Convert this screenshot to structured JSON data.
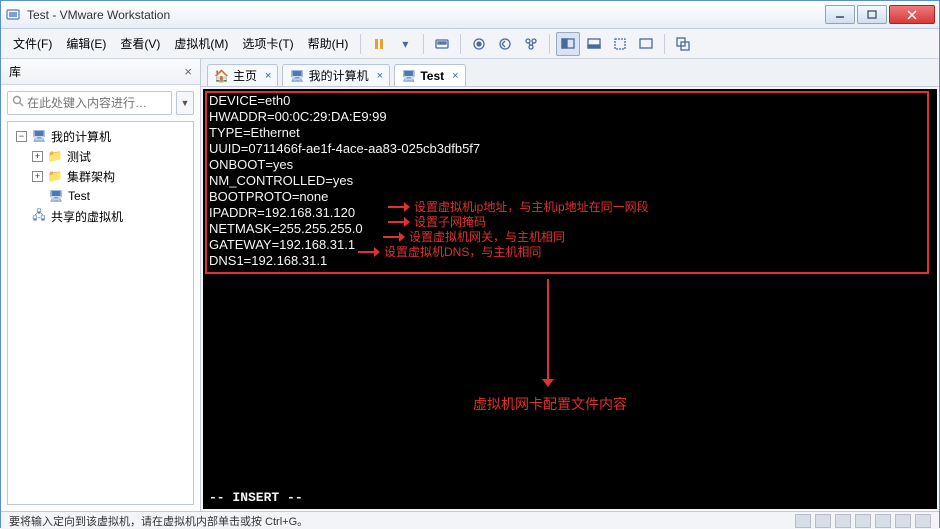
{
  "window": {
    "title": "Test - VMware Workstation"
  },
  "menu": {
    "file": "文件(F)",
    "edit": "编辑(E)",
    "view": "查看(V)",
    "vm": "虚拟机(M)",
    "tabs": "选项卡(T)",
    "help": "帮助(H)"
  },
  "sidebar": {
    "header": "库",
    "search_placeholder": "在此处键入内容进行…",
    "root": "我的计算机",
    "items": {
      "0": "测试",
      "1": "集群架构",
      "2": "Test"
    },
    "shared": "共享的虚拟机"
  },
  "tabs": {
    "home": "主页",
    "mycomp": "我的计算机",
    "test": "Test"
  },
  "terminal": {
    "l0": "DEVICE=eth0",
    "l1": "HWADDR=00:0C:29:DA:E9:99",
    "l2": "TYPE=Ethernet",
    "l3": "UUID=0711466f-ae1f-4ace-aa83-025cb3dfb5f7",
    "l4": "ONBOOT=yes",
    "l5": "NM_CONTROLLED=yes",
    "l6": "BOOTPROTO=none",
    "l7": "IPADDR=192.168.31.120",
    "l8": "NETMASK=255.255.255.0",
    "l9": "GATEWAY=192.168.31.1",
    "l10": "DNS1=192.168.31.1",
    "insert": "-- INSERT --"
  },
  "annot": {
    "a1": "设置虚拟机ip地址，与主机ip地址在同一网段",
    "a2": "设置子网掩码",
    "a3": "设置虚拟机网关，与主机相同",
    "a4": "设置虚拟机DNS，与主机相同",
    "bottom": "虚拟机网卡配置文件内容"
  },
  "status": {
    "text": "要将输入定向到该虚拟机，请在虚拟机内部单击或按 Ctrl+G。"
  }
}
